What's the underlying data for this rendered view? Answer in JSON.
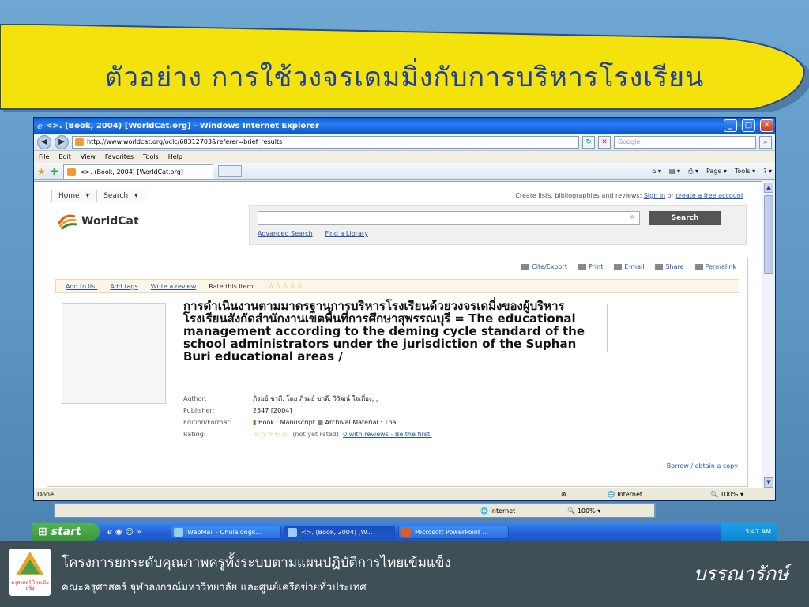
{
  "slide": {
    "title": "ตัวอย่าง  การใช้วงจรเดมมิ่งกับการบริหารโรงเรียน",
    "footer_line1": "โครงการยกระดับคุณภาพครูทั้งระบบตามแผนปฏิบัติการไทยเข้มแข็ง",
    "footer_line2": "คณะครุศาสตร์ จุฬาลงกรณ์มหาวิทยาลัย และศูนย์เครือข่ายทั่วประเทศ",
    "footer_right": "บรรณารักษ์",
    "logo_text": "ครุศาสตร์ ไทยเข้มแข็ง"
  },
  "browser": {
    "window_title": "<>. (Book, 2004) [WorldCat.org] - Windows Internet Explorer",
    "url": "http://www.worldcat.org/oclc/68312703&referer=brief_results",
    "search_placeholder": "Google",
    "menu": [
      "File",
      "Edit",
      "View",
      "Favorites",
      "Tools",
      "Help"
    ],
    "tab_label": "<>. (Book, 2004) [WorldCat.org]",
    "cmd_page": "Page",
    "cmd_tools": "Tools",
    "status_left": "Done",
    "status_zone": "Internet",
    "status_zoom": "100%"
  },
  "worldcat": {
    "nav_home": "Home",
    "nav_search": "Search",
    "top_text": "Create lists, bibliographies and reviews:",
    "sign_in": "Sign in",
    "or": "or",
    "create_account": "create a free account",
    "logo": "WorldCat",
    "search_button": "Search",
    "advanced_search": "Advanced Search",
    "find_library": "Find a Library",
    "actions": [
      "Cite/Export",
      "Print",
      "E-mail",
      "Share",
      "Permalink"
    ],
    "add_to_list": "Add to list",
    "add_tags": "Add tags",
    "write_review": "Write a review",
    "rate_item": "Rate this item:",
    "rating_stars": "☆☆☆☆☆",
    "title": "การดำเนินงานตามมาตรฐานการบริหารโรงเรียนด้วยวงจรเดมิ่งของผู้บริหารโรงเรียนสังกัดสำนักงานเขตพื้นที่การศึกษาสุพรรณบุรี = The educational management according to the deming cycle standard of the school administrators under the jurisdiction of the Suphan Buri educational areas /",
    "author_label": "Author:",
    "author_value": "ภิรมย์ ขาดี. โดย ภิรมย์ ขาดี. วิวัฒน์ ใจเที่ยง, ;",
    "publisher_label": "Publisher:",
    "publisher_value": "2547 [2004]",
    "edition_label": "Edition/Format:",
    "edition_value": "Book : Manuscript",
    "edition_value2": "Archival Material : Thai",
    "rating_label": "Rating:",
    "rating_note": "(not yet rated)",
    "reviews_link": "0 with reviews - Be the first.",
    "borrow_link": "Borrow / obtain a copy"
  },
  "inner_status": {
    "zone": "Internet",
    "zoom": "100%"
  },
  "taskbar": {
    "start": "start",
    "items": [
      "WebMail - Chulalongk...",
      "<>. (Book, 2004) [W...",
      "Microsoft PowerPoint ..."
    ],
    "clock": "3:47 AM"
  },
  "colors": {
    "banner_fill": "#f3e20c",
    "title_color": "#1f3f9a",
    "link": "#2255aa",
    "footer_bg": "#3f4f56"
  }
}
